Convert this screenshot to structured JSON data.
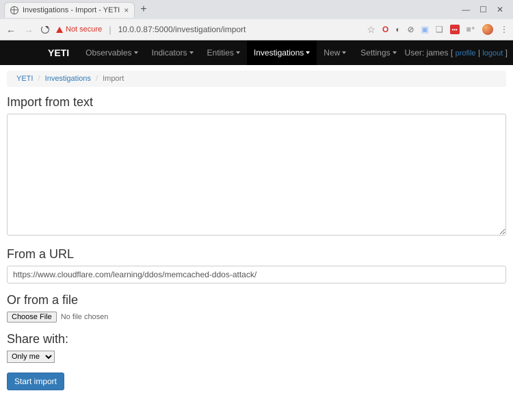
{
  "browser": {
    "tab_title": "Investigations - Import - YETI",
    "not_secure": "Not secure",
    "url": "10.0.0.87:5000/investigation/import"
  },
  "navbar": {
    "brand": "YETI",
    "items": [
      {
        "label": "Observables"
      },
      {
        "label": "Indicators"
      },
      {
        "label": "Entities"
      },
      {
        "label": "Investigations",
        "active": true
      },
      {
        "label": "New"
      }
    ],
    "settings": "Settings",
    "user_prefix": "User:",
    "username": "james",
    "profile": "profile",
    "logout": "logout"
  },
  "breadcrumb": {
    "items": [
      "YETI",
      "Investigations",
      "Import"
    ]
  },
  "form": {
    "import_text_title": "Import from text",
    "import_text_value": "",
    "url_title": "From a URL",
    "url_value": "https://www.cloudflare.com/learning/ddos/memcached-ddos-attack/",
    "file_title": "Or from a file",
    "file_btn": "Choose File",
    "file_status": "No file chosen",
    "share_title": "Share with:",
    "share_value": "Only me",
    "submit": "Start import"
  }
}
